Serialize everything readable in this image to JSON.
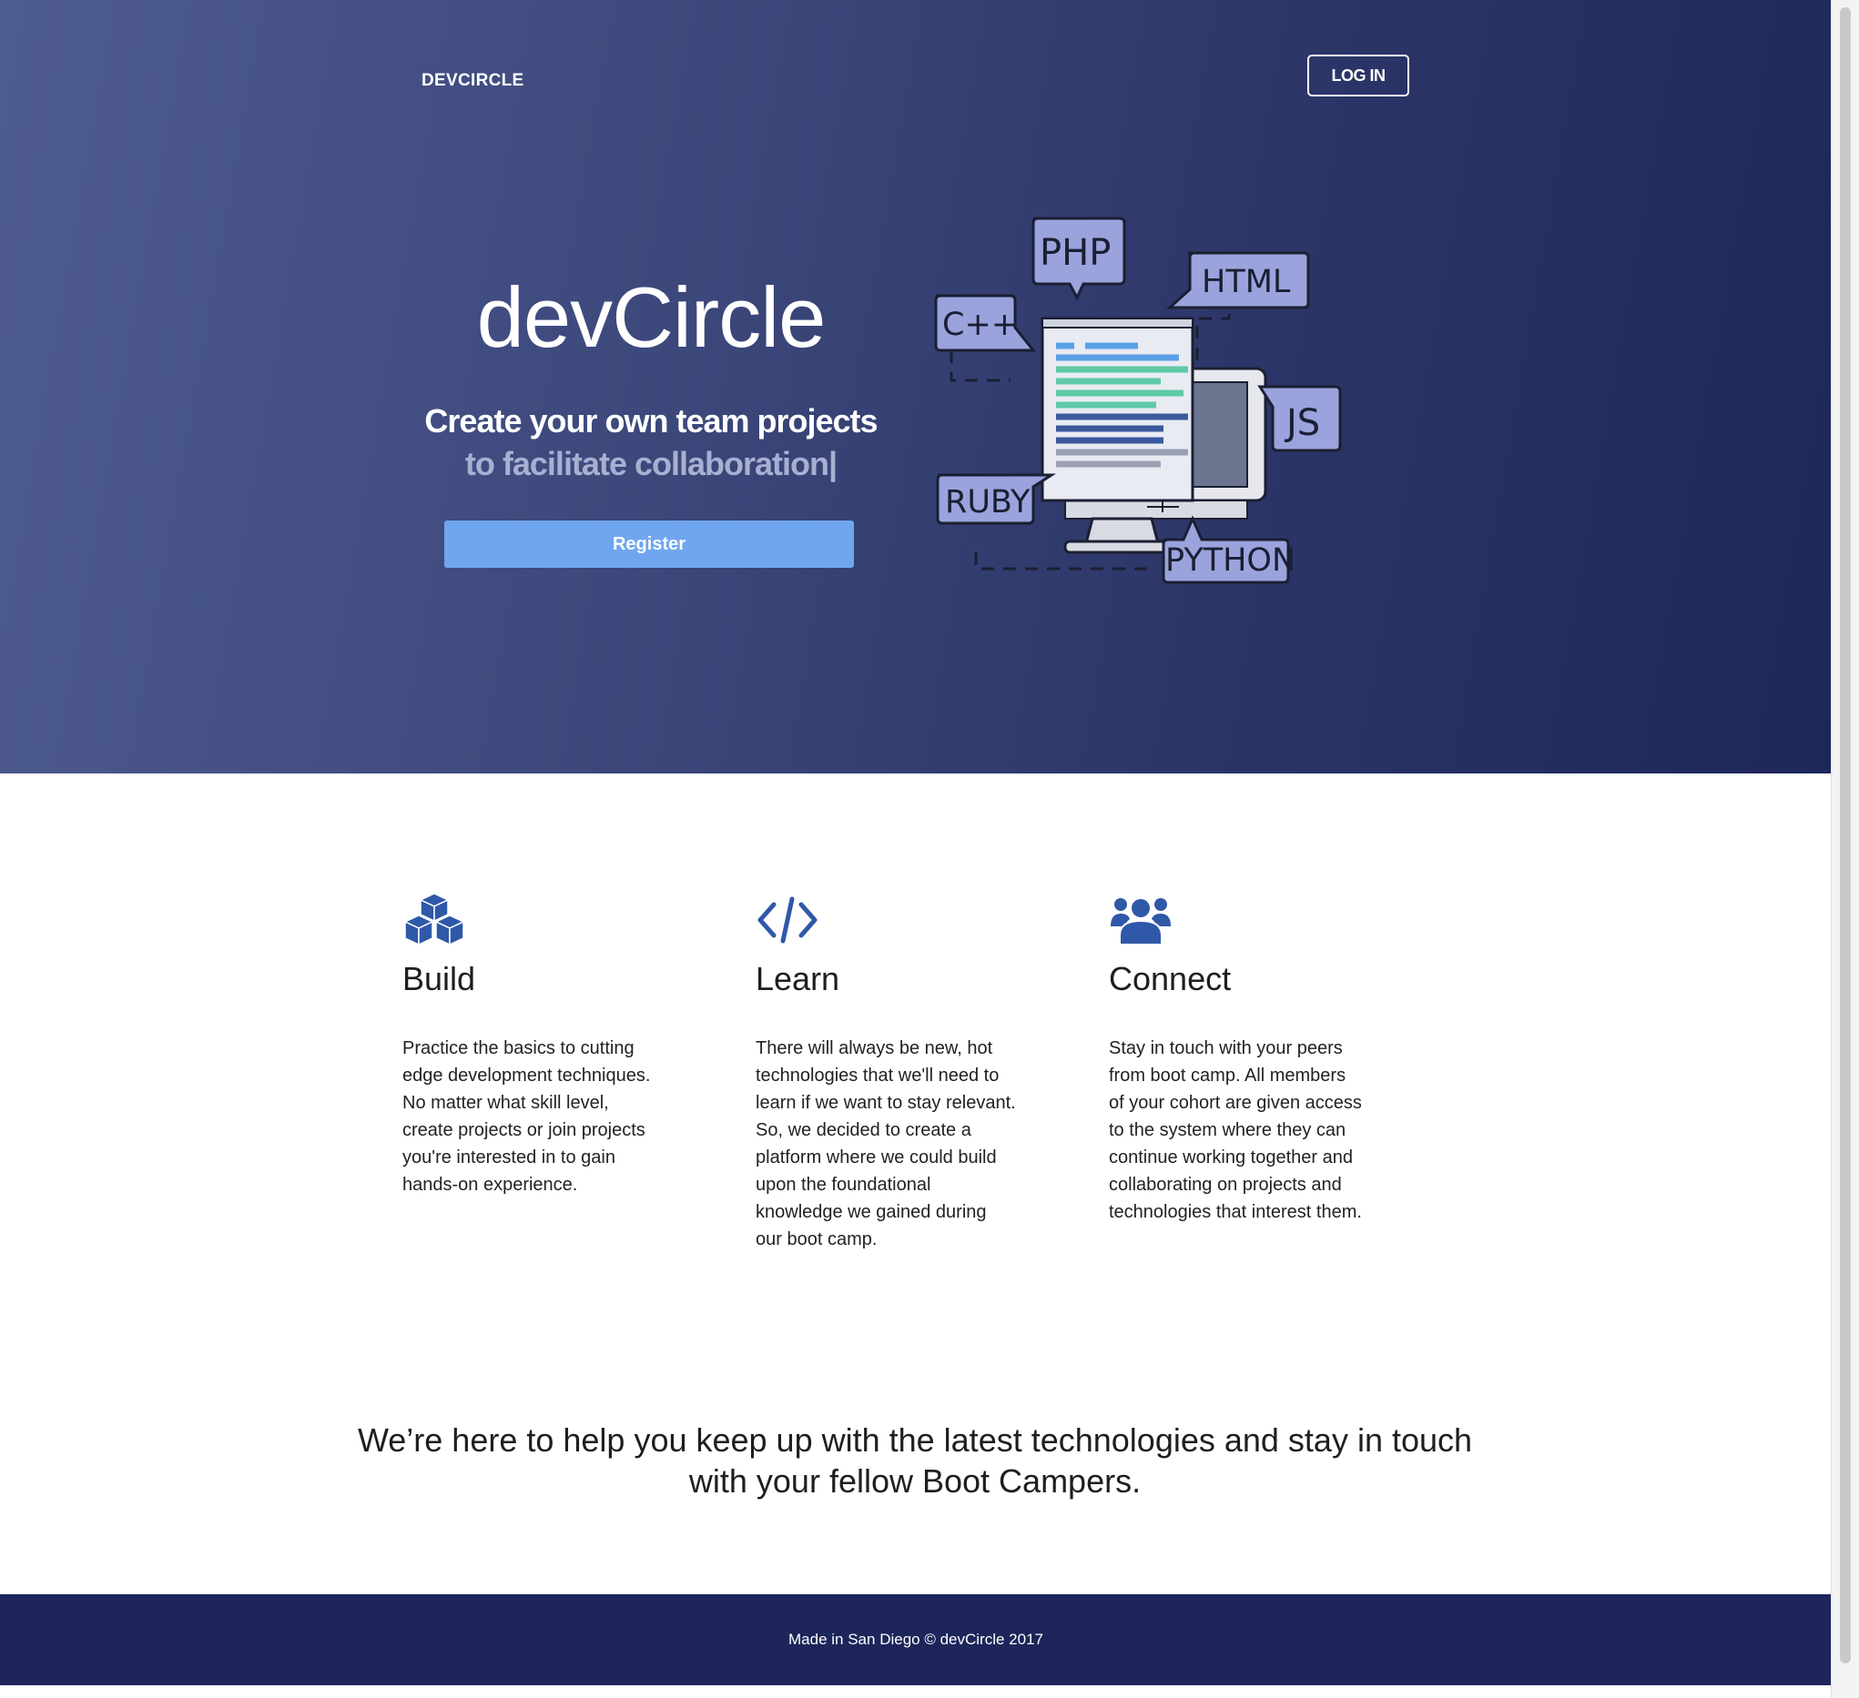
{
  "header": {
    "brand": "DEVCIRCLE",
    "login_label": "LOG IN"
  },
  "hero": {
    "title": "devCircle",
    "tagline": "Create your own team projects",
    "typed_text": "to facilitate collaboration|",
    "register_label": "Register",
    "illustration_labels": [
      "PHP",
      "HTML",
      "C++",
      "JS",
      "RUBY",
      "PYTHON"
    ]
  },
  "features": [
    {
      "icon": "cubes-icon",
      "title": "Build",
      "text_lines": [
        "Practice the basics to cutting",
        "edge development techniques.",
        "No matter what skill level,",
        "create projects or join projects",
        "you're interested in to gain",
        "hands-on experience."
      ]
    },
    {
      "icon": "code-icon",
      "title": "Learn",
      "text_lines": [
        "There will always be new, hot",
        "technologies that we'll need to",
        "learn if we want to stay relevant.",
        "So, we decided to create a",
        "platform where we could build",
        "upon the foundational",
        "knowledge we gained during",
        "our boot camp."
      ]
    },
    {
      "icon": "users-icon",
      "title": "Connect",
      "text_lines": [
        "Stay in touch with your peers",
        "from boot camp. All members",
        "of your cohort are given access",
        "to the system where they can",
        "continue working together and",
        "collaborating on projects and",
        "technologies that interest them."
      ]
    }
  ],
  "mission": {
    "line1": "We’re here to help you keep up with the latest technologies and stay in touch",
    "line2": "with your fellow Boot Campers."
  },
  "footer": {
    "text": "Made in San Diego © devCircle 2017"
  },
  "colors": {
    "hero_start": "#4f5c91",
    "hero_end": "#1e2759",
    "register": "#6fa6ef",
    "icon_blue": "#2f58a8",
    "footer": "#1d255a",
    "bubble": "#9aa3dc"
  }
}
